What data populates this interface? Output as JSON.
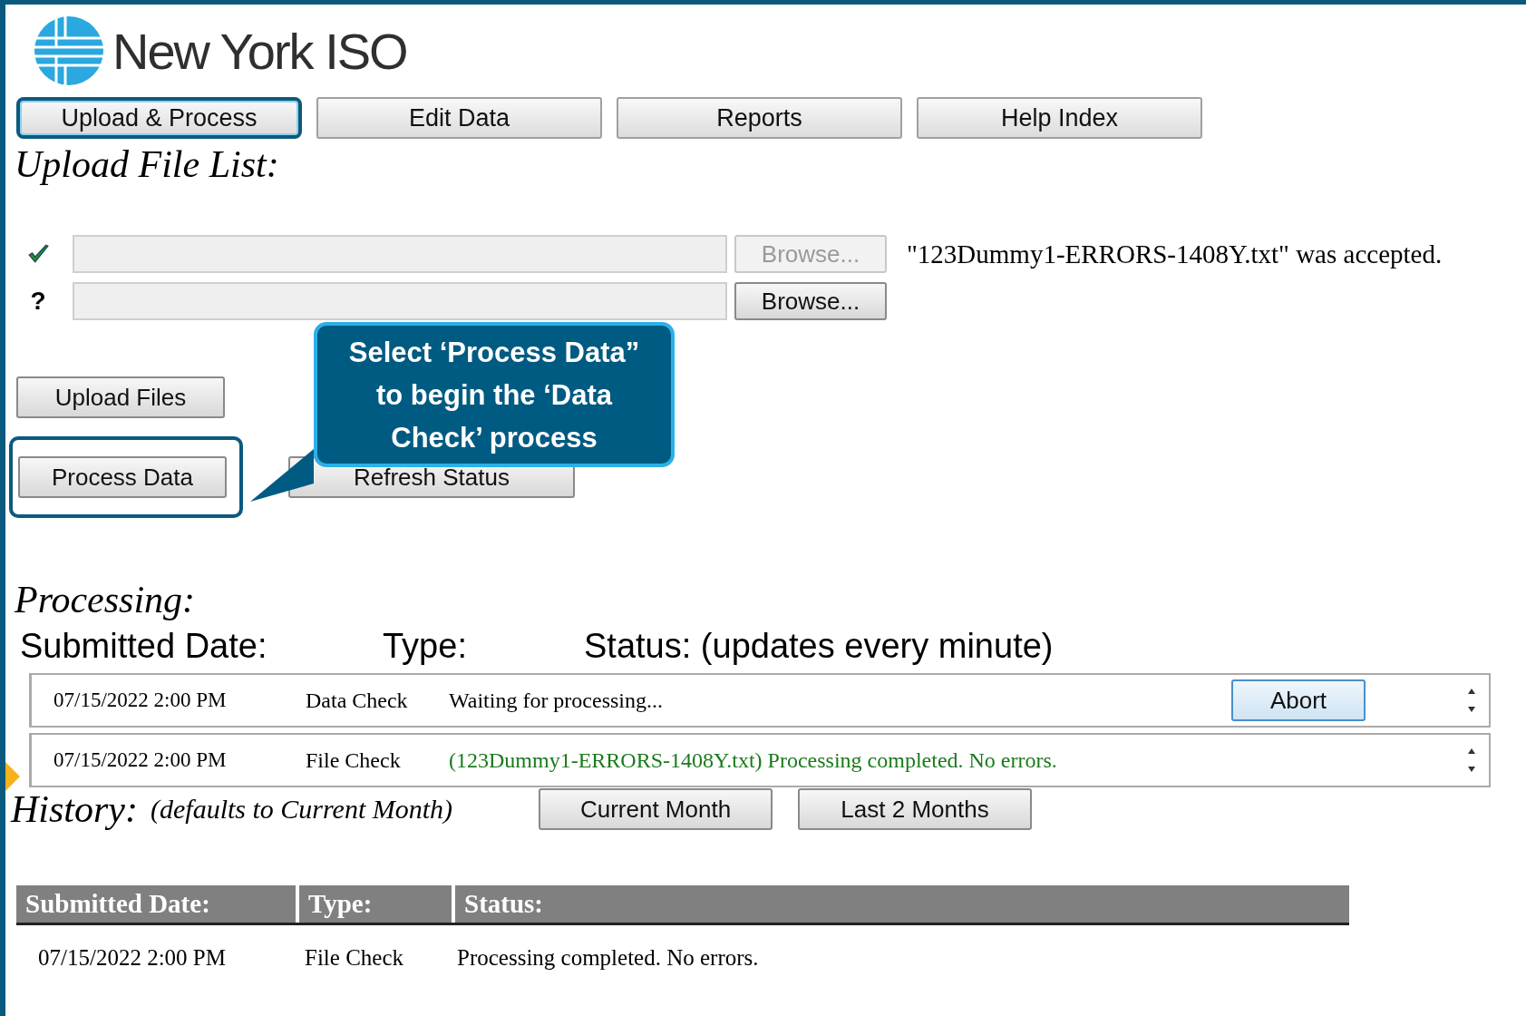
{
  "logo": {
    "text": "New York ISO"
  },
  "tabs": [
    {
      "label": "Upload & Process",
      "selected": true
    },
    {
      "label": "Edit Data",
      "selected": false
    },
    {
      "label": "Reports",
      "selected": false
    },
    {
      "label": "Help Index",
      "selected": false
    }
  ],
  "upload_heading": "Upload File List:",
  "file_rows": [
    {
      "kind": "accepted",
      "browse": "Browse...",
      "disabled": true,
      "message": "\"123Dummy1-ERRORS-1408Y.txt\" was accepted."
    },
    {
      "kind": "pending",
      "status_icon": "?",
      "browse": "Browse...",
      "disabled": false
    }
  ],
  "upload_button": {
    "label": "Upload Files"
  },
  "process_button": {
    "label": "Process Data",
    "highlighted": true
  },
  "refresh_button": {
    "label": "Refresh Status"
  },
  "callout": {
    "lines": [
      "Select  ‘Process Data”",
      "to begin the ‘Data",
      "Check’ process"
    ]
  },
  "processing_heading": "Processing:",
  "processing_columns": [
    "Submitted Date:",
    "Type:",
    "Status: (updates every minute)"
  ],
  "processing_rows": [
    {
      "date": "07/15/2022 2:00 PM",
      "type": "Data Check",
      "status": "Waiting for processing...",
      "color": "#000000",
      "action": "Abort"
    },
    {
      "date": "07/15/2022 2:00 PM",
      "type": "File Check",
      "status": "(123Dummy1-ERRORS-1408Y.txt) Processing completed. No errors.",
      "color": "#1a7a1a"
    }
  ],
  "history": {
    "heading": "History:",
    "note": "(defaults to Current Month)",
    "buttons": [
      "Current Month",
      "Last 2 Months"
    ]
  },
  "history_table": {
    "columns": [
      "Submitted Date:",
      "Type:",
      "Status:"
    ],
    "rows": [
      [
        "07/15/2022 2:00 PM",
        "File Check",
        "Processing completed. No errors."
      ]
    ]
  }
}
